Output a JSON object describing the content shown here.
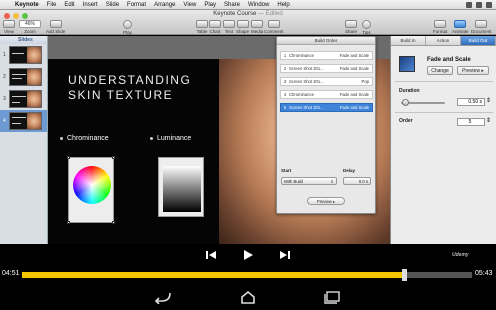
{
  "menubar": {
    "app_name": "Keynote",
    "items": [
      "File",
      "Edit",
      "Insert",
      "Slide",
      "Format",
      "Arrange",
      "View",
      "Play",
      "Share",
      "Window",
      "Help"
    ]
  },
  "window": {
    "title": "Keynote Course",
    "title_suffix": "— Edited"
  },
  "toolbar": {
    "view_label": "View",
    "zoom_value": "46%",
    "zoom_label": "Zoom",
    "add_slide_label": "Add Slide",
    "play_label": "Play",
    "table_label": "Table",
    "chart_label": "Chart",
    "text_label": "Text",
    "shape_label": "Shape",
    "media_label": "Media",
    "comment_label": "Comment",
    "share_label": "Share",
    "tips_label": "Tips",
    "format_label": "Format",
    "animate_label": "Animate",
    "document_label": "Document"
  },
  "navigator": {
    "header": "Slides",
    "slides": [
      {
        "num": "1",
        "selected": false
      },
      {
        "num": "2",
        "selected": false
      },
      {
        "num": "3",
        "selected": false
      },
      {
        "num": "4",
        "selected": true
      }
    ]
  },
  "slide": {
    "title": "UNDERSTANDING\nSKIN TEXTURE",
    "bullet_1": "Chrominance",
    "bullet_2": "Luminance"
  },
  "build_order": {
    "title": "Build Order",
    "rows": [
      {
        "num": "1",
        "name": "Chrominance",
        "effect": "Fade and Scale",
        "selected": false
      },
      {
        "num": "2",
        "name": "Screen Shot 201...",
        "effect": "Fade and Scale",
        "selected": false
      },
      {
        "num": "3",
        "name": "Screen Shot 201...",
        "effect": "Pop",
        "selected": false
      },
      {
        "num": "4",
        "name": "Chrominance",
        "effect": "Fade and Scale",
        "selected": false
      },
      {
        "num": "5",
        "name": "Screen Shot 201...",
        "effect": "Fade and Scale",
        "selected": true
      }
    ],
    "start_label": "Start",
    "start_value": "With Build",
    "delay_label": "Delay",
    "delay_value": "0.0 s",
    "preview_label": "Preview"
  },
  "inspector": {
    "tabs": [
      "Build In",
      "Action",
      "Build Out"
    ],
    "active_tab": "Build Out",
    "effect_name": "Fade and Scale",
    "change_label": "Change",
    "preview_label": "Preview",
    "duration_label": "Duration",
    "duration_value": "0.50 s",
    "duration_fraction": 0.1,
    "order_label": "Order",
    "order_value": "5"
  },
  "video": {
    "elapsed": "04:51",
    "total": "05:43",
    "progress_fraction": 0.848,
    "watermark": "Udemy"
  },
  "colors": {
    "accent": "#3c83d9",
    "progress": "#f5c400"
  }
}
